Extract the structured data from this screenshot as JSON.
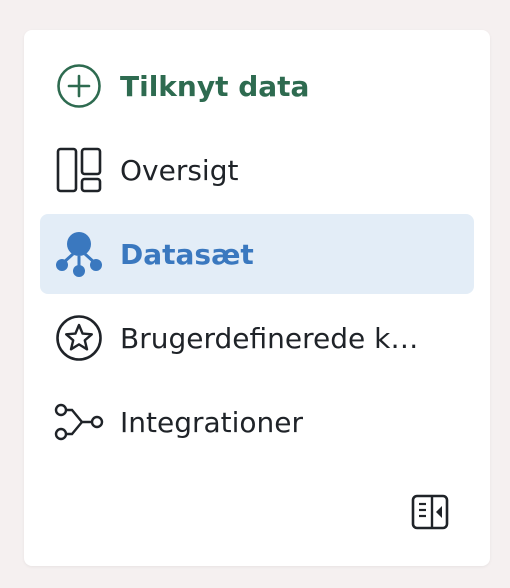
{
  "nav": {
    "items": [
      {
        "label": "Tilknyt data",
        "icon": "plus-circle-icon"
      },
      {
        "label": "Oversigt",
        "icon": "dashboard-layout-icon"
      },
      {
        "label": "Datasæt",
        "icon": "dataset-nodes-icon",
        "active": true
      },
      {
        "label": "Brugerdefinerede k…",
        "icon": "star-circle-icon"
      },
      {
        "label": "Integrationer",
        "icon": "integration-flow-icon"
      }
    ]
  },
  "colors": {
    "accent_green": "#2e6b50",
    "active_blue": "#3a78bf",
    "active_bg": "#e3edf7",
    "text": "#1f2328"
  },
  "footer": {
    "collapse_icon": "collapse-panel-icon"
  }
}
